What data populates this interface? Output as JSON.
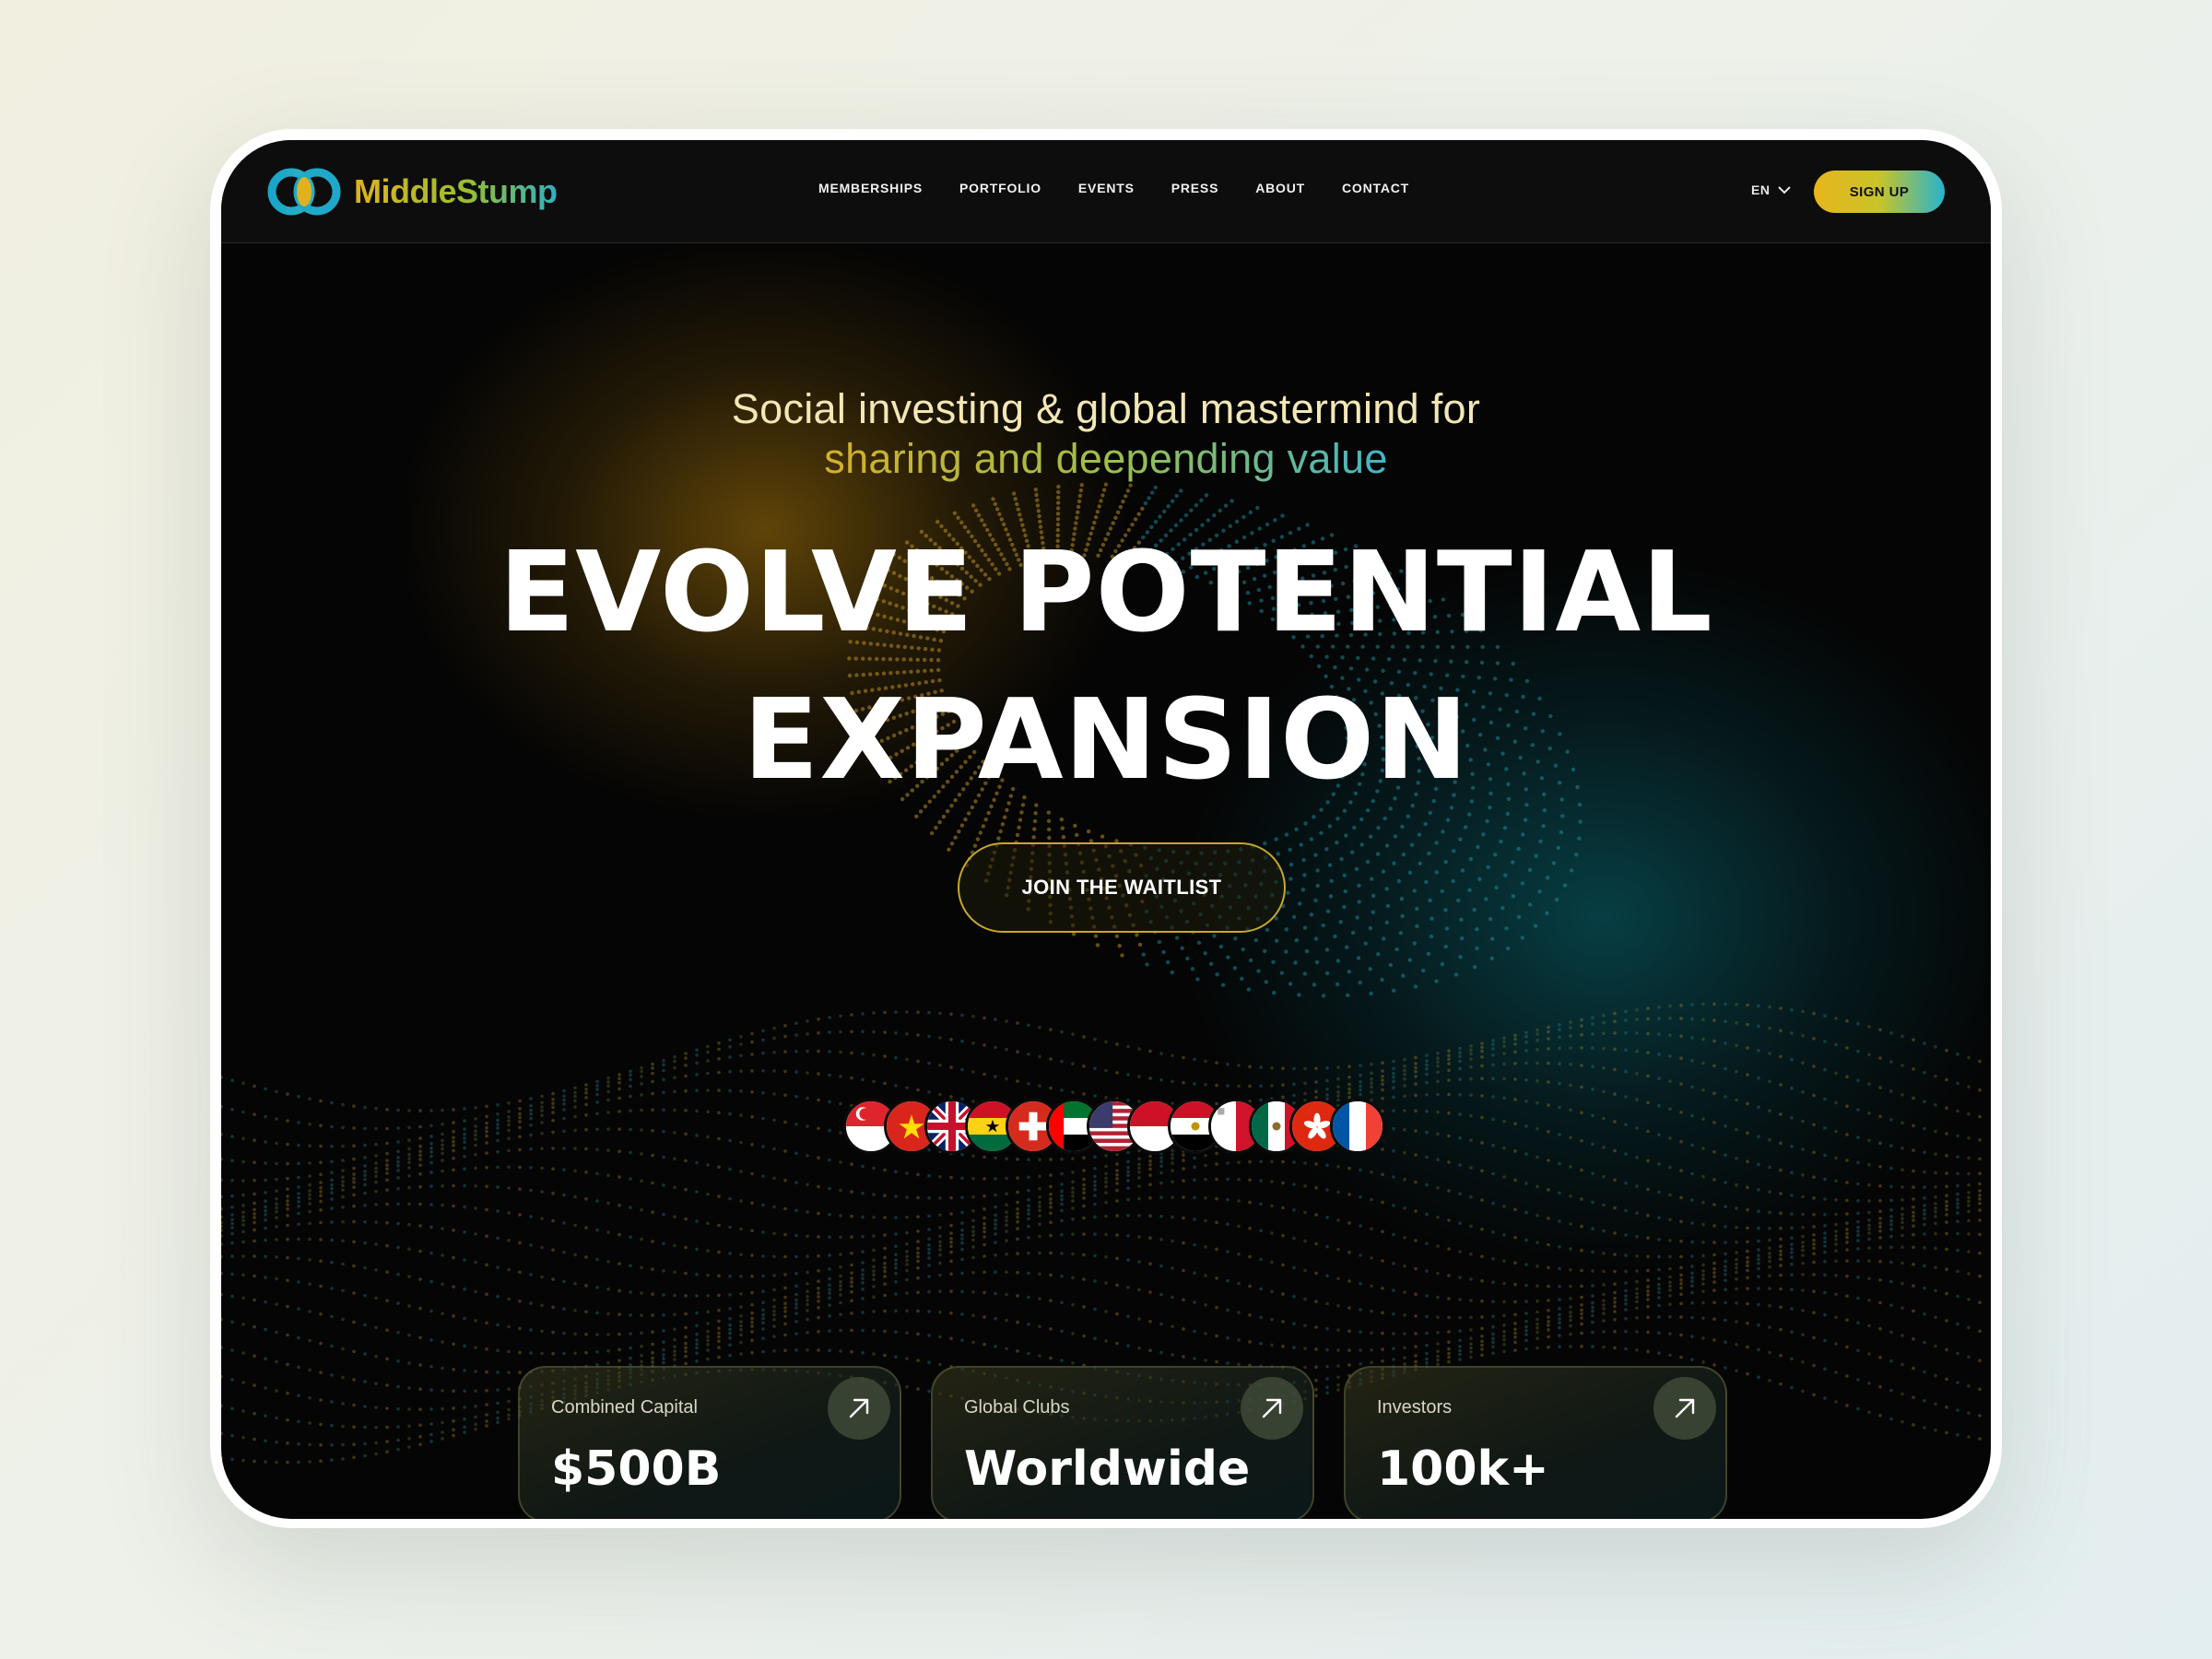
{
  "brand": {
    "name": "MiddleStump"
  },
  "nav": {
    "items": [
      "MEMBERSHIPS",
      "PORTFOLIO",
      "EVENTS",
      "PRESS",
      "ABOUT",
      "CONTACT"
    ],
    "language": "EN",
    "signup_label": "SIGN UP"
  },
  "hero": {
    "subtitle_line1": "Social investing & global mastermind for",
    "subtitle_line2": "sharing and deepending value",
    "headline_line1": "EVOLVE POTENTIAL",
    "headline_line2": "EXPANSION",
    "cta_label": "JOIN THE WAITLIST"
  },
  "flags": [
    "singapore",
    "vietnam",
    "united-kingdom",
    "ghana",
    "switzerland",
    "uae",
    "usa",
    "indonesia",
    "cyprus",
    "malta",
    "mexico",
    "hong-kong",
    "france"
  ],
  "stats": [
    {
      "label": "Combined Capital",
      "value": "$500B"
    },
    {
      "label": "Global Clubs",
      "value": "Worldwide"
    },
    {
      "label": "Investors",
      "value": "100k+"
    }
  ],
  "colors": {
    "gold": "#e0b21e",
    "teal": "#2fb0c4",
    "background": "#050505"
  }
}
